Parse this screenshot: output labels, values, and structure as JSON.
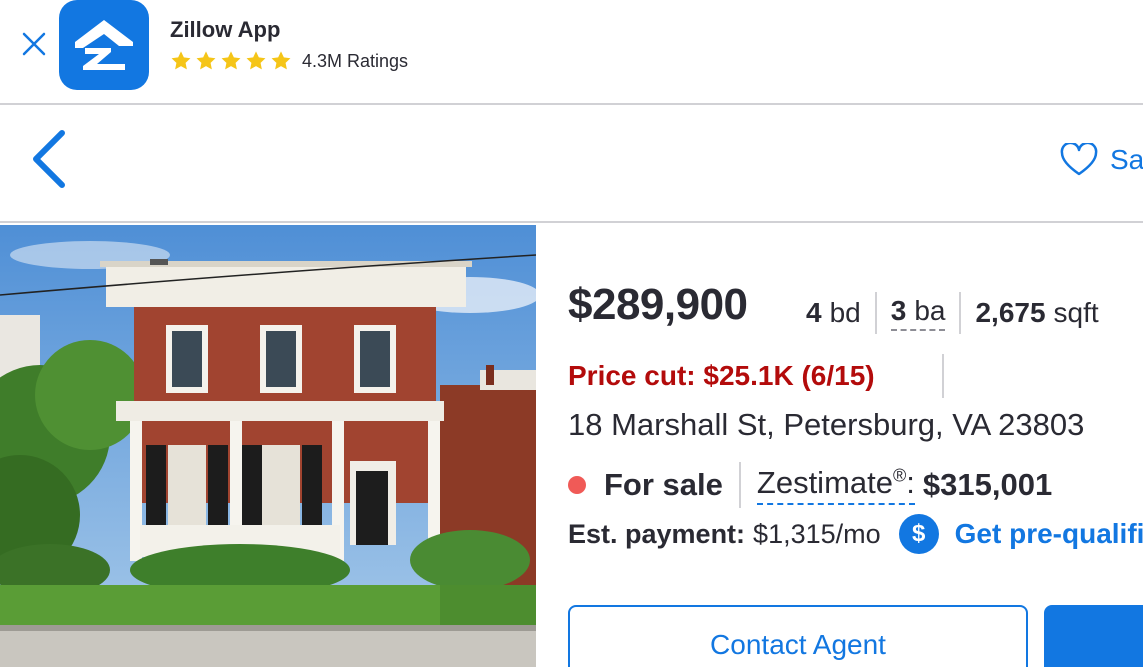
{
  "banner": {
    "app_name": "Zillow App",
    "rating_stars": 5,
    "ratings_text": "4.3M Ratings"
  },
  "nav": {
    "save_label": "Save"
  },
  "listing": {
    "price": "$289,900",
    "beds_value": "4",
    "beds_unit": "bd",
    "baths_value": "3",
    "baths_unit": "ba",
    "sqft_value": "2,675",
    "sqft_unit": "sqft",
    "price_cut": "Price cut: $25.1K (6/15)",
    "address": "18 Marshall St, Petersburg, VA 23803",
    "status": "For sale",
    "zestimate_label": "Zestimate",
    "zestimate_mark": "®",
    "zestimate_value": "$315,001",
    "payment_label": "Est. payment:",
    "payment_value": "$1,315/mo",
    "prequal_label": "Get pre-qualified",
    "contact_label": "Contact Agent"
  },
  "colors": {
    "brand_blue": "#1277e1",
    "price_cut_red": "#b30b0b",
    "status_dot": "#f05a57",
    "star_yellow": "#f5c518"
  }
}
